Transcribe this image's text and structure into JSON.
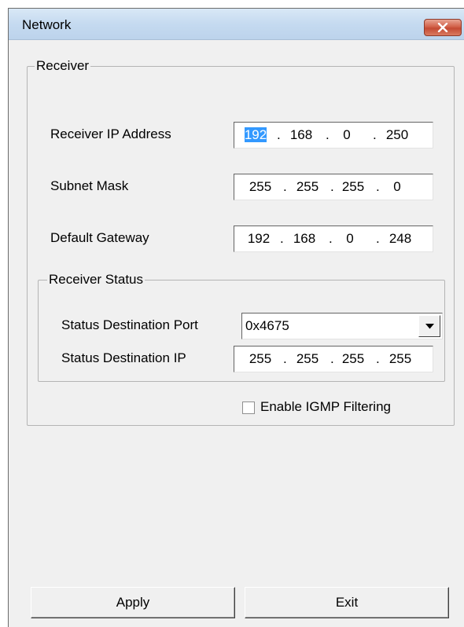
{
  "window": {
    "title": "Network",
    "close_glyph": "X"
  },
  "receiver": {
    "group_title": "Receiver",
    "ip_label": "Receiver IP Address",
    "ip": [
      "192",
      "168",
      "0",
      "250"
    ],
    "subnet_label": "Subnet Mask",
    "subnet": [
      "255",
      "255",
      "255",
      "0"
    ],
    "gateway_label": "Default Gateway",
    "gateway": [
      "192",
      "168",
      "0",
      "248"
    ]
  },
  "status": {
    "group_title": "Receiver Status",
    "port_label": "Status Destination Port",
    "port_value": "0x4675",
    "dest_ip_label": "Status Destination IP",
    "dest_ip": [
      "255",
      "255",
      "255",
      "255"
    ]
  },
  "igmp": {
    "label": "Enable IGMP Filtering",
    "checked": false
  },
  "buttons": {
    "apply": "Apply",
    "exit": "Exit"
  },
  "colors": {
    "selection": "#3399ff",
    "close_button": "#c44a33",
    "titlebar": "#c5daf0",
    "dialog_bg": "#f0f0f0"
  },
  "icons": {
    "close": "close-icon",
    "dropdown": "chevron-down-icon"
  }
}
